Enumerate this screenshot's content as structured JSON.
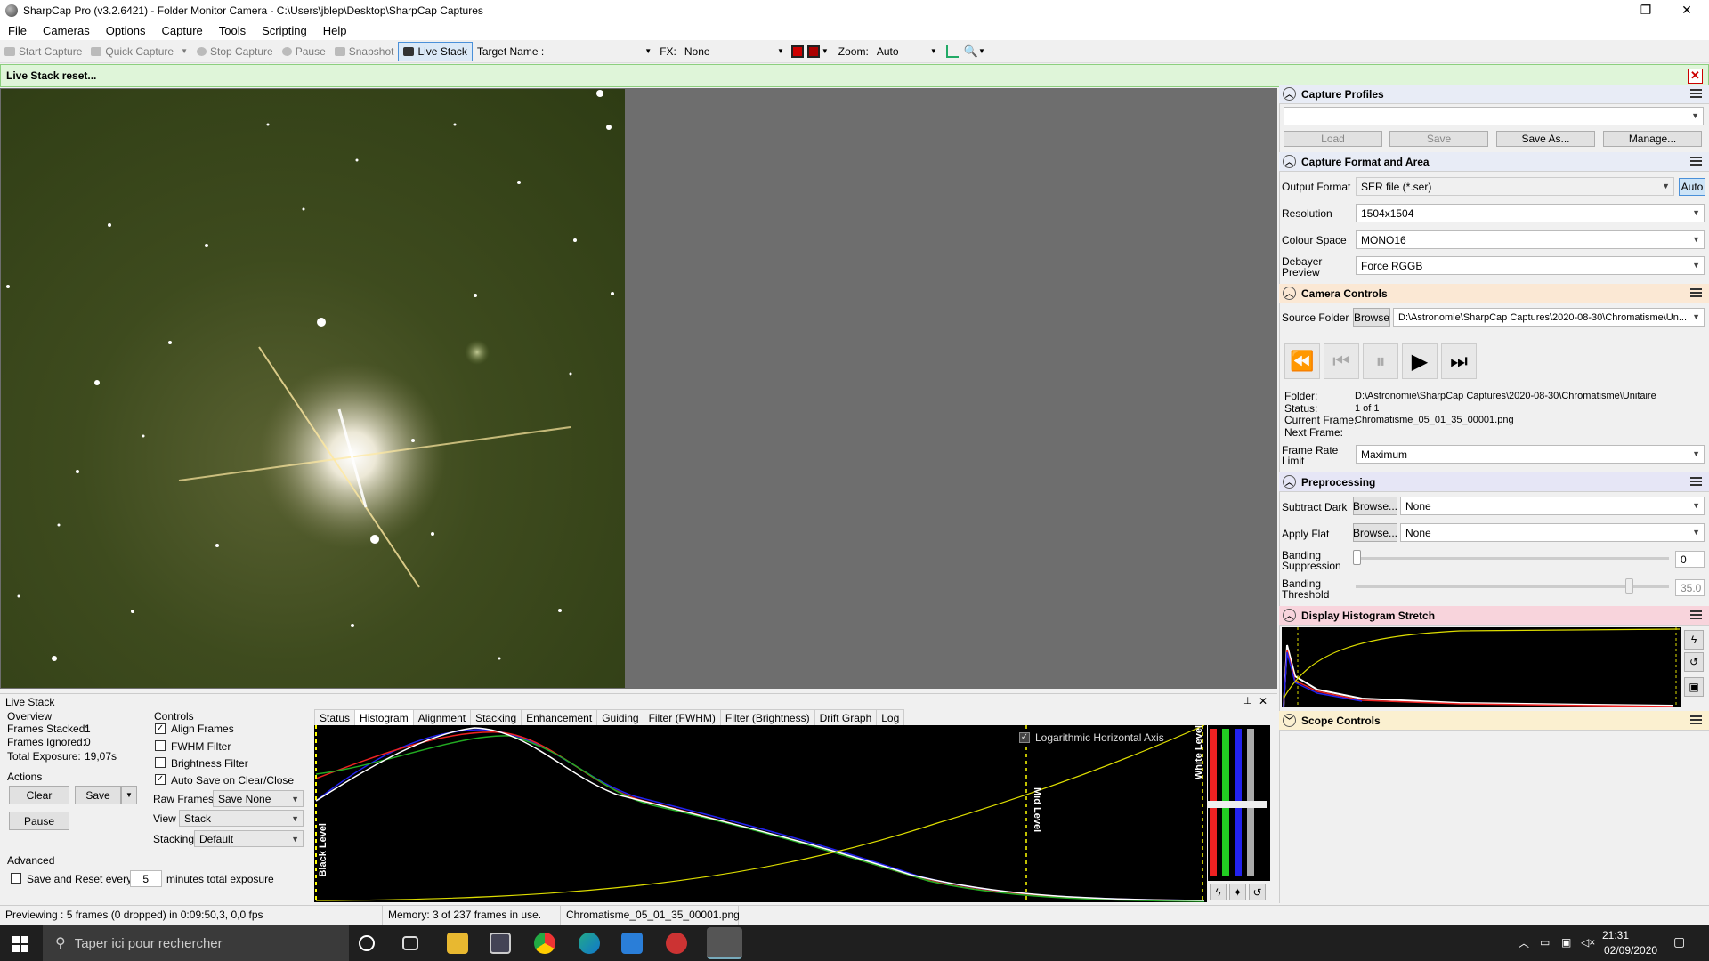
{
  "window": {
    "title": "SharpCap Pro (v3.2.6421) - Folder Monitor Camera - C:\\Users\\jblep\\Desktop\\SharpCap Captures",
    "min": "—",
    "max": "❐",
    "close": "✕"
  },
  "menu": [
    "File",
    "Cameras",
    "Options",
    "Capture",
    "Tools",
    "Scripting",
    "Help"
  ],
  "toolbar": {
    "start": "Start Capture",
    "quick": "Quick Capture",
    "stop": "Stop Capture",
    "pause": "Pause",
    "snapshot": "Snapshot",
    "livestack": "Live Stack",
    "target_label": "Target Name :",
    "fx_label": "FX:",
    "fx_value": "None",
    "zoom_label": "Zoom:",
    "zoom_value": "Auto"
  },
  "notification": {
    "text": "Live Stack reset...",
    "close": "✕"
  },
  "right_panel": {
    "capture_profiles": {
      "title": "Capture Profiles",
      "load": "Load",
      "save": "Save",
      "save_as": "Save As...",
      "manage": "Manage..."
    },
    "capture_format": {
      "title": "Capture Format and Area",
      "output_format_label": "Output Format",
      "output_format": "SER file (*.ser)",
      "auto": "Auto",
      "resolution_label": "Resolution",
      "resolution": "1504x1504",
      "colour_space_label": "Colour Space",
      "colour_space": "MONO16",
      "debayer_label1": "Debayer",
      "debayer_label2": "Preview",
      "debayer": "Force RGGB"
    },
    "camera_controls": {
      "title": "Camera Controls",
      "source_folder_label": "Source Folder",
      "browse": "Browse",
      "source_folder": "D:\\Astronomie\\SharpCap Captures\\2020-08-30\\Chromatisme\\Un...",
      "folder_label": "Folder:",
      "folder": "D:\\Astronomie\\SharpCap Captures\\2020-08-30\\Chromatisme\\Unitaire",
      "status_label": "Status:",
      "status": "1 of 1",
      "current_label": "Current Frame:",
      "current": "Chromatisme_05_01_35_00001.png",
      "next_label": "Next Frame:",
      "frame_rate_label1": "Frame Rate",
      "frame_rate_label2": "Limit",
      "frame_rate": "Maximum"
    },
    "preprocessing": {
      "title": "Preprocessing",
      "subtract_dark_label": "Subtract Dark",
      "apply_flat_label": "Apply Flat",
      "browse": "Browse...",
      "none": "None",
      "banding_supp_label1": "Banding",
      "banding_supp_label2": "Suppression",
      "banding_supp": "0",
      "banding_thr_label1": "Banding",
      "banding_thr_label2": "Threshold",
      "banding_thr": "35.0"
    },
    "display_histogram": {
      "title": "Display Histogram Stretch"
    },
    "scope_controls": {
      "title": "Scope Controls"
    }
  },
  "live_stack": {
    "title": "Live Stack",
    "pin": "⊥",
    "close": "✕",
    "overview": "Overview",
    "frames_stacked_label": "Frames Stacked:",
    "frames_stacked": "1",
    "frames_ignored_label": "Frames Ignored:",
    "frames_ignored": "0",
    "total_exposure_label": "Total Exposure:",
    "total_exposure": "19,07s",
    "actions": "Actions",
    "clear": "Clear",
    "save": "Save",
    "pause": "Pause",
    "advanced": "Advanced",
    "save_reset": "Save and Reset every",
    "save_reset_value": "5",
    "minutes": "minutes total exposure",
    "controls": "Controls",
    "align_frames": "Align Frames",
    "fwhm_filter": "FWHM Filter",
    "brightness_filter": "Brightness Filter",
    "auto_save": "Auto Save on Clear/Close",
    "raw_frames_label": "Raw Frames",
    "raw_frames": "Save None",
    "view_label": "View",
    "view": "Stack",
    "stacking_label": "Stacking",
    "stacking": "Default",
    "tabs": [
      "Status",
      "Histogram",
      "Alignment",
      "Stacking",
      "Enhancement",
      "Guiding",
      "Filter (FWHM)",
      "Filter (Brightness)",
      "Drift Graph",
      "Log"
    ],
    "log_axis": "Logarithmic Horizontal Axis",
    "black_level": "Black Level",
    "mid_level": "Mid Level",
    "white_level": "White Level"
  },
  "statusbar": {
    "previewing": "Previewing : 5 frames (0 dropped) in 0:09:50,3, 0,0 fps",
    "memory": "Memory: 3 of 237 frames in use.",
    "file": "Chromatisme_05_01_35_00001.png"
  },
  "taskbar": {
    "search": "Taper ici pour rechercher",
    "time": "21:31",
    "date": "02/09/2020"
  }
}
